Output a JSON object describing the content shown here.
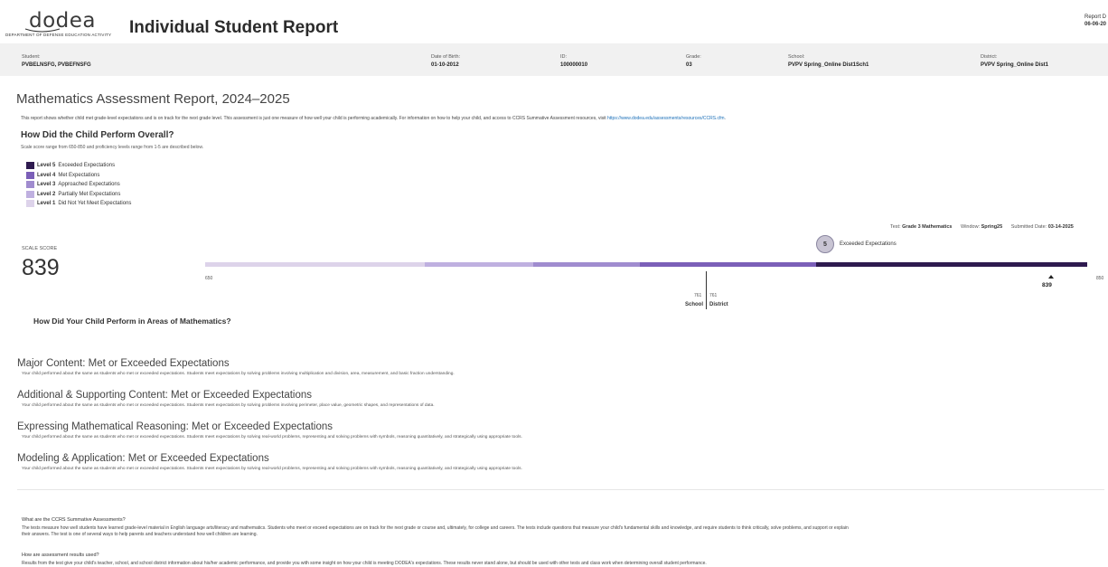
{
  "header": {
    "logo_word": "dodea",
    "logo_sub": "DEPARTMENT OF DEFENSE EDUCATION ACTIVITY",
    "title": "Individual Student Report",
    "report_date_label": "Report D",
    "report_date_value": "06-06-20"
  },
  "student_info": {
    "student_label": "Student:",
    "student_value": "PVBELNSFG, PVBEFNSFG",
    "dob_label": "Date of Birth:",
    "dob_value": "01-10-2012",
    "id_label": "ID:",
    "id_value": "100000010",
    "grade_label": "Grade:",
    "grade_value": "03",
    "school_label": "School:",
    "school_value": "PVPV Spring_Online Dist1Sch1",
    "district_label": "District:",
    "district_value": "PVPV Spring_Online Dist1"
  },
  "assessment": {
    "title": "Mathematics Assessment Report, 2024–2025",
    "intro_text": "This report shows whether child met grade-level expectations and is on track for the next grade level. This assessment is just one measure of how well your child is performing academically. For information on how to help your child, and access to CCRS Summative Assessment resources, visit ",
    "intro_link": "https://www.dodea.edu/assessments/resources/CCRS.cfm",
    "intro_end": ".",
    "perform_heading": "How Did the Child Perform Overall?",
    "scale_desc": "Scale score range from 650-850 and proficiency levels range from 1-5 are described below."
  },
  "levels": [
    {
      "level": "Level 5",
      "desc": "Exceeded Expectations",
      "color": "#2e1a4f"
    },
    {
      "level": "Level 4",
      "desc": "Met Expectations",
      "color": "#7b5fb8"
    },
    {
      "level": "Level 3",
      "desc": "Approached Expectations",
      "color": "#a08ccf"
    },
    {
      "level": "Level 2",
      "desc": "Partially Met Expectations",
      "color": "#bfb0e0"
    },
    {
      "level": "Level 1",
      "desc": "Did Not Yet Meet Expectations",
      "color": "#ddd3ea"
    }
  ],
  "test_meta": {
    "test_label": "Test:",
    "test_value": "Grade 3 Mathematics",
    "window_label": "Window:",
    "window_value": "Spring25",
    "submitted_label": "Submitted Date:",
    "submitted_value": "03-14-2025"
  },
  "score": {
    "label": "SCALE SCORE",
    "value": "839",
    "level_number": "5",
    "level_text": "Exceeded Expectations",
    "range_min": "650",
    "range_max": "850",
    "marker_value": "839",
    "school_value": "761",
    "district_value": "761",
    "school_label": "School",
    "district_label": "District"
  },
  "areas_heading": "How Did Your Child Perform in Areas of Mathematics?",
  "areas": [
    {
      "title": "Major Content: Met or Exceeded Expectations",
      "desc": "Your child performed about the same as students who met or exceeded expectations. Students meet expectations by solving problems involving multiplication and division, area, measurement, and basic fraction understanding."
    },
    {
      "title": "Additional & Supporting Content: Met or Exceeded Expectations",
      "desc": "Your child performed about the same as students who met or exceeded expectations. Students meet expectations by solving problems involving perimeter, place value, geometric shapes, and representations of data."
    },
    {
      "title": "Expressing Mathematical Reasoning: Met or Exceeded Expectations",
      "desc": "Your child performed about the same as students who met or exceeded expectations. Students meet expectations by solving real-world problems, representing and solving problems with symbols, reasoning quantitatively, and strategically using appropriate tools."
    },
    {
      "title": "Modeling & Application: Met or Exceeded Expectations",
      "desc": "Your child performed about the same as students who met or exceeded expectations. Students meet expectations by solving real-world problems, representing and solving problems with symbols, reasoning quantitatively, and strategically using appropriate tools."
    }
  ],
  "faq": [
    {
      "q": "What are the CCRS Summative Assessments?",
      "a1": "The tests measure how well students have learned grade-level material in English language arts/literacy and mathematics. Students who meet or exceed expectations are on track for the next grade or course and, ultimately, for college and careers. The tests include questions that measure your child's fundamental skills and knowledge, and require students to think critically, solve problems, and support or explain",
      "a2": "their answers. The test is one of several ways to help parents and teachers understand how well children are learning."
    },
    {
      "q": "How are assessment results used?",
      "a1": "Results from the test give your child's teacher, school, and school district information about his/her academic performance, and provide you with some insight on how your child is meeting DODEA's expectations. These results never stand alone, but should be used with other tests and class work when determining overall student performance.",
      "a2": ""
    }
  ]
}
